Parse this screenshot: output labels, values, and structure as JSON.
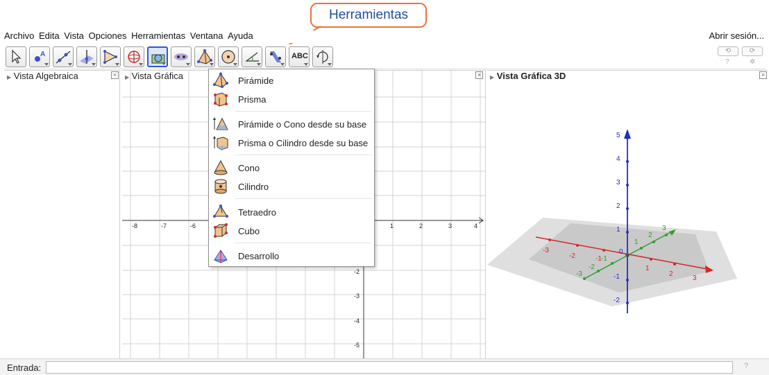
{
  "callout": {
    "text": "Herramientas"
  },
  "menubar": {
    "items": [
      "Archivo",
      "Edita",
      "Vista",
      "Opciones",
      "Herramientas",
      "Ventana",
      "Ayuda"
    ],
    "login": "Abrir sesión..."
  },
  "toolbar": {
    "tools": [
      {
        "icon": "move-arrow-icon"
      },
      {
        "icon": "point-icon"
      },
      {
        "icon": "line-icon"
      },
      {
        "icon": "perpendicular-icon"
      },
      {
        "icon": "polygon-icon"
      },
      {
        "icon": "sphere-icon"
      },
      {
        "icon": "plane-through-points-icon",
        "selected": true
      },
      {
        "icon": "intersect-surfaces-icon"
      },
      {
        "icon": "pyramid-icon"
      },
      {
        "icon": "circle-point-icon"
      },
      {
        "icon": "angle-icon"
      },
      {
        "icon": "reflect-icon"
      },
      {
        "icon": "text-abc-icon",
        "label": "ABC"
      },
      {
        "icon": "rotate-view-icon"
      }
    ],
    "undo": "⟲",
    "redo": "⟳"
  },
  "panels": {
    "algebra_title": "Vista Algebraica",
    "graphics_title": "Vista Gráfica",
    "graphics3d_title": "Vista Gráfica 3D"
  },
  "dropdown": {
    "groups": [
      [
        {
          "label": "Pirámide",
          "icon": "pyramid-icon"
        },
        {
          "label": "Prisma",
          "icon": "prism-icon"
        }
      ],
      [
        {
          "label": "Pirámide o Cono desde su base",
          "icon": "extrude-pyramid-icon"
        },
        {
          "label": "Prisma o Cilindro desde su base",
          "icon": "extrude-prism-icon"
        }
      ],
      [
        {
          "label": "Cono",
          "icon": "cone-icon"
        },
        {
          "label": "Cilindro",
          "icon": "cylinder-icon"
        }
      ],
      [
        {
          "label": "Tetraedro",
          "icon": "tetrahedron-icon"
        },
        {
          "label": "Cubo",
          "icon": "cube-icon"
        }
      ],
      [
        {
          "label": "Desarrollo",
          "icon": "net-icon"
        }
      ]
    ]
  },
  "graphics": {
    "x_ticks": [
      "-8",
      "-7",
      "-6",
      "1",
      "2",
      "3",
      "4"
    ],
    "y_ticks": [
      "-2",
      "-3",
      "-4",
      "-5"
    ]
  },
  "graphics3d": {
    "z_ticks": [
      "5",
      "4",
      "3",
      "2",
      "1",
      "0",
      "-1",
      "-2"
    ],
    "x_ticks": [
      "-3",
      "-2",
      "-1",
      "1",
      "2",
      "3"
    ],
    "y_ticks": [
      "-3",
      "-2",
      "-1",
      "1",
      "2",
      "3"
    ],
    "colors": {
      "x": "#d62728",
      "y": "#2ca02c",
      "z": "#1f2ecc"
    }
  },
  "input": {
    "label": "Entrada:",
    "value": ""
  }
}
